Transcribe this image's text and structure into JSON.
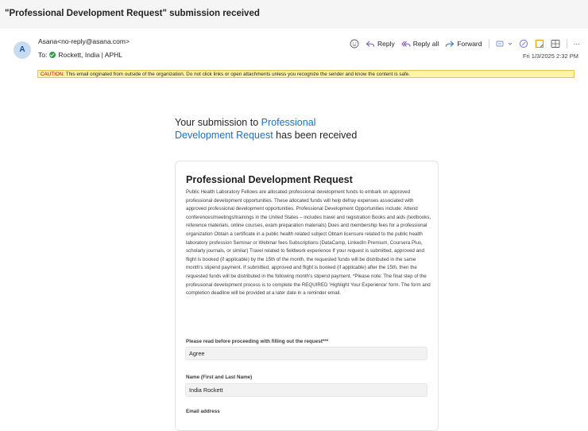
{
  "email": {
    "subject": "\"Professional Development Request\" submission received",
    "avatar_initial": "A",
    "sender": "Asana<no-reply@asana.com>",
    "to_prefix": "To:",
    "to_recipient": "Rockett, India | APHL",
    "date": "Fri 1/3/2025 2:32 PM",
    "caution_prefix": "CAUTION:",
    "caution_text": "This email originated from outside of the organization. Do not click links or open attachments unless you recognize the sender and know the content is safe."
  },
  "toolbar": {
    "reply_label": "Reply",
    "reply_all_label": "Reply all",
    "forward_label": "Forward",
    "more_label": "···"
  },
  "body": {
    "received_prefix": "Your submission to",
    "received_link": "Professional Development Request",
    "received_suffix": "has been received",
    "form_title": "Professional Development Request",
    "form_description": "Public Health Laboratory Fellows are allocated professional development funds to embark on approved professional development opportunities. These allocated funds will help defray expenses associated with approved professional development opportunities.  Professional Development Opportunities include: Attend conferences/meetings/trainings in the United States – includes travel and registration Books and aids (textbooks, reference materials, online courses, exam preparation materials) Dues and membership fees for a professional organization Obtain a certificate in a public health related subject Obtain licensure related to the public health laboratory profession Seminar or Webinar fees Subscriptions (DataCamp, LinkedIn Premium, Coursera Plus, scholarly journals, or similar) Travel related to fieldwork experience If your request is submitted, approved and flight is booked (if applicable) by the 15th of the month, the requested funds will be distributed in the same month's stipend payment. If submitted, approved and flight is booked (if applicable) after the 15th, then the requested funds will be distributed in the following month's stipend payment. *Please note: The final step of the professional development process is to complete the REQUIRED 'Highlight Your Experience' form. The form and completion deadline will be provided at a later date in a reminder email.",
    "fields": [
      {
        "label": "Please read before proceeding with filling out the request***",
        "value": "Agree"
      },
      {
        "label": "Name (First and Last Name)",
        "value": "India Rockett"
      },
      {
        "label": "Email address",
        "value": ""
      }
    ]
  },
  "colors": {
    "link": "#1f6fbf",
    "caution_bg": "#fff5a5",
    "status_green": "#2aa147",
    "avatar_bg": "#c7dcf1"
  }
}
